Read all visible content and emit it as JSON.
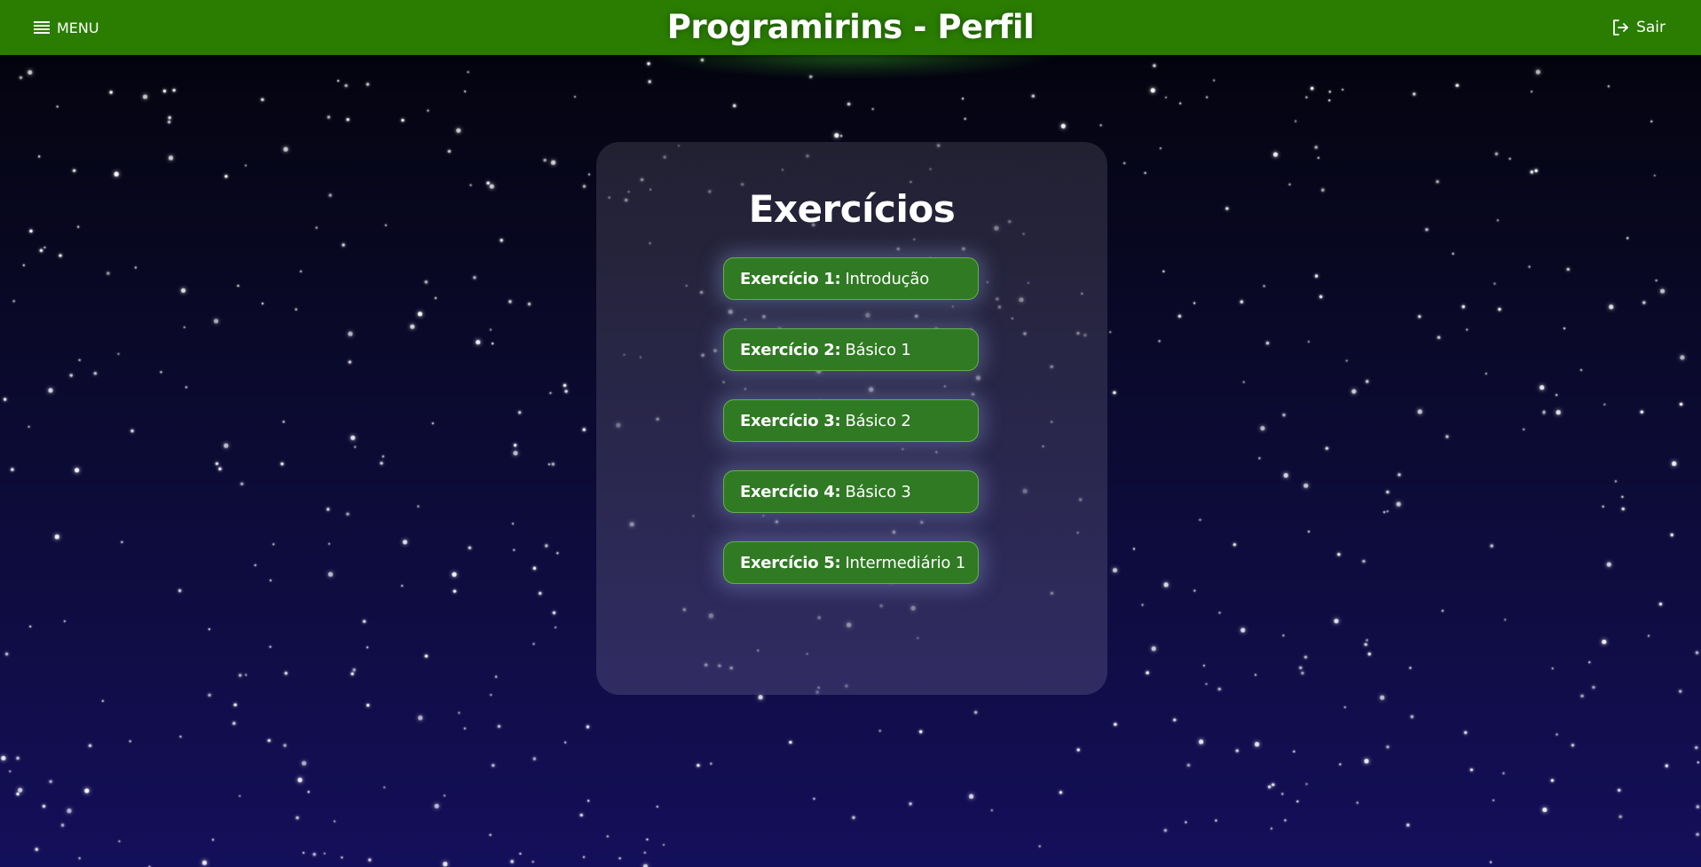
{
  "header": {
    "menu_label": "MENU",
    "title": "Programirins - Perfil",
    "logout_label": "Sair"
  },
  "card": {
    "title": "Exercícios",
    "exercises": [
      {
        "number": "Exercício 1:",
        "name": "Introdução"
      },
      {
        "number": "Exercício 2:",
        "name": "Básico 1"
      },
      {
        "number": "Exercício 3:",
        "name": "Básico 2"
      },
      {
        "number": "Exercício 4:",
        "name": "Básico 3"
      },
      {
        "number": "Exercício 5:",
        "name": "Intermediário 1"
      }
    ]
  },
  "icons": {
    "menu": "hamburger-icon",
    "logout": "logout-icon"
  },
  "colors": {
    "header_bg": "#2a7d00",
    "button_bg": "#2f7a22",
    "text": "#ffffff"
  }
}
